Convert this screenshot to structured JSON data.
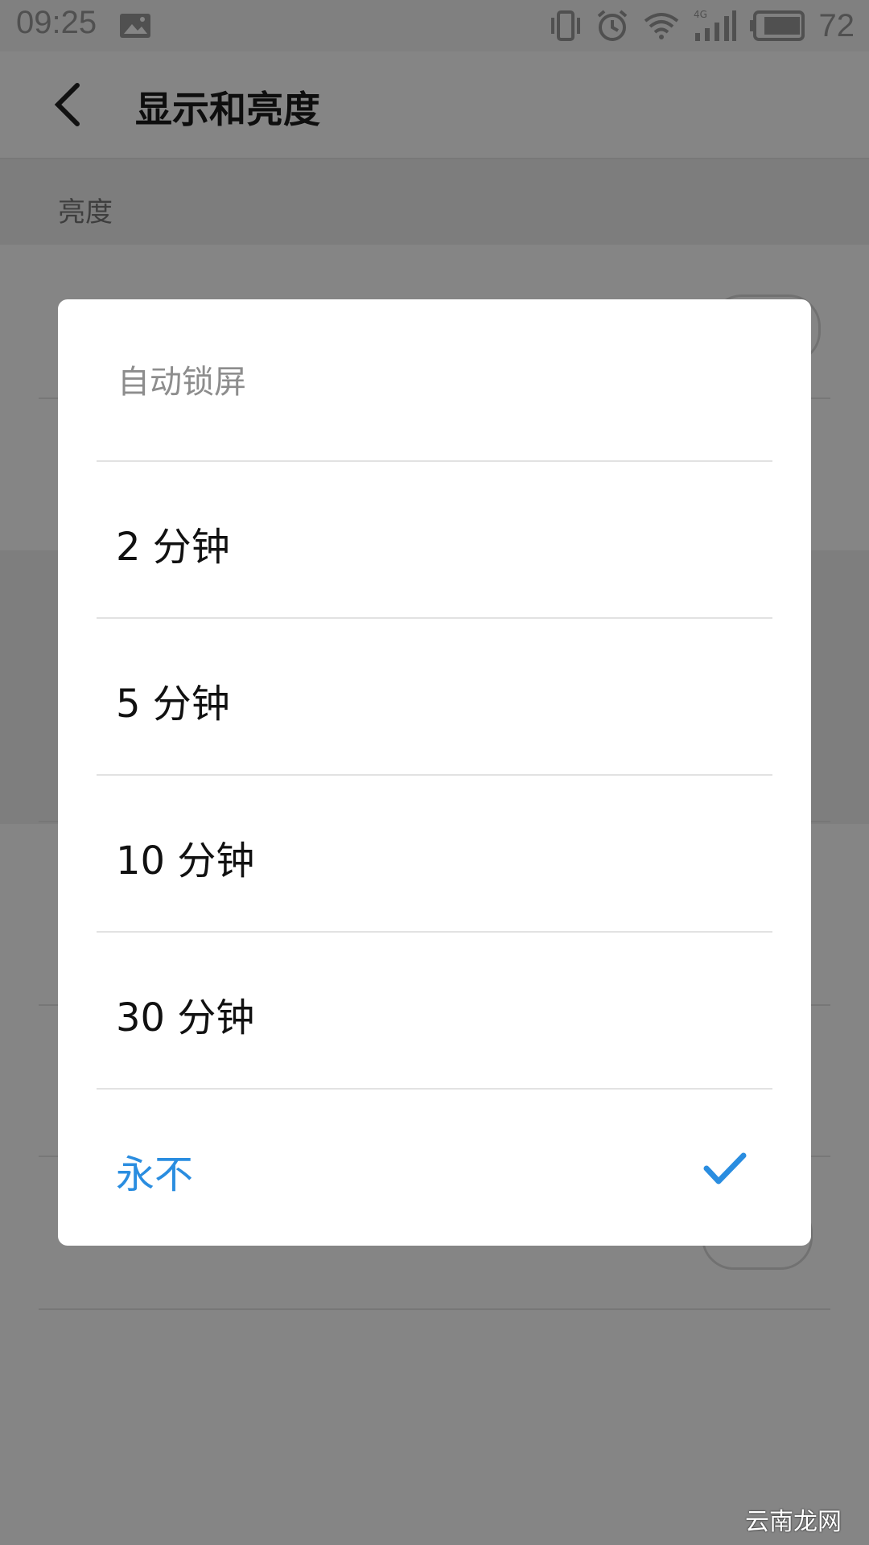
{
  "status_bar": {
    "time": "09:25",
    "battery_level": "72",
    "icons": [
      "photo-icon",
      "vibrate-icon",
      "alarm-icon",
      "wifi-icon",
      "signal-4g-icon",
      "battery-icon"
    ]
  },
  "header": {
    "title": "显示和亮度"
  },
  "section": {
    "label": "亮度"
  },
  "dialog": {
    "title": "自动锁屏",
    "options": [
      {
        "label": "2 分钟",
        "selected": false
      },
      {
        "label": "5 分钟",
        "selected": false
      },
      {
        "label": "10 分钟",
        "selected": false
      },
      {
        "label": "30 分钟",
        "selected": false
      },
      {
        "label": "永不",
        "selected": true
      }
    ]
  },
  "colors": {
    "accent": "#2a8de0",
    "overlay": "rgba(0,0,0,0.48)"
  },
  "watermark": "云南龙网"
}
